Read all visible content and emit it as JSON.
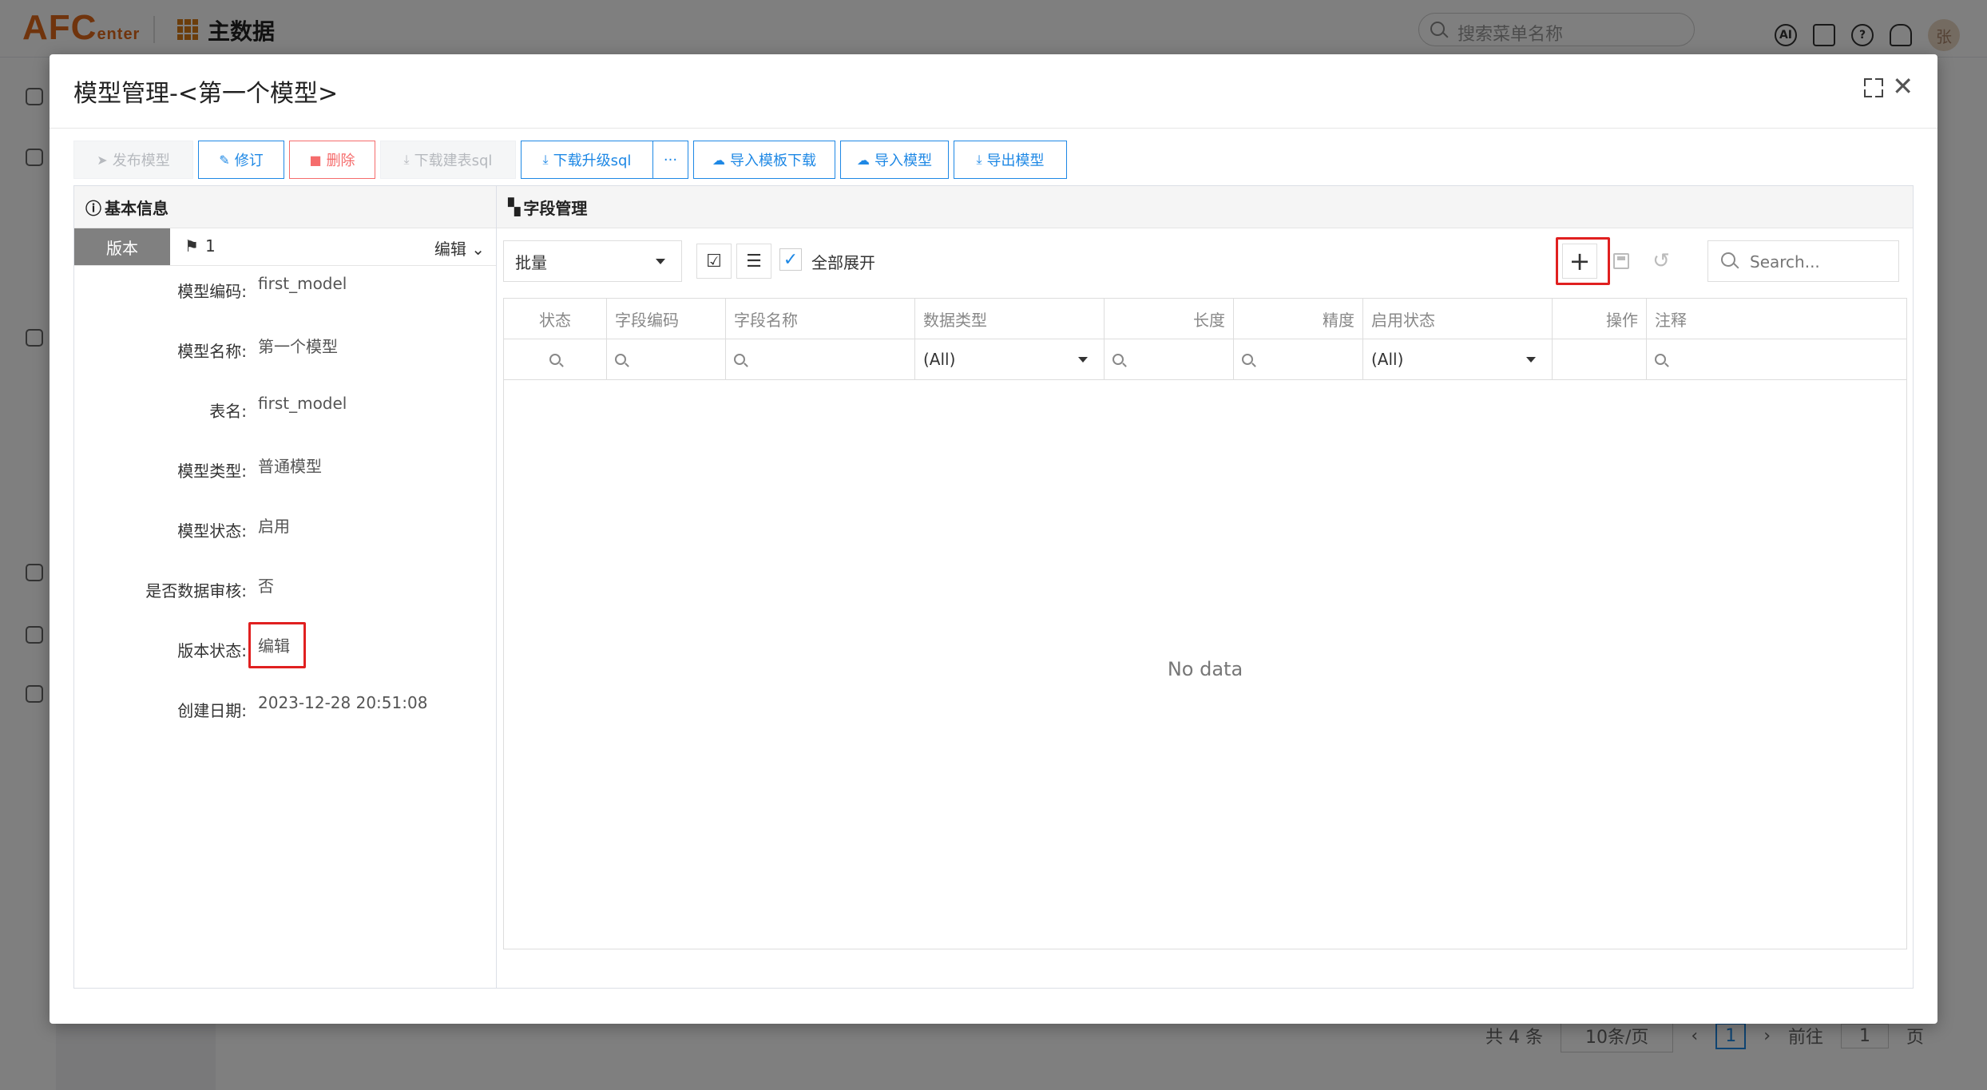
{
  "app": {
    "logo_main": "AFC",
    "logo_sub": "enter",
    "title": "主数据",
    "search_placeholder": "搜索菜单名称",
    "avatar_text": "张",
    "ai_icon_text": "AI",
    "help_icon_text": "?"
  },
  "background_footer": {
    "total": "共 4 条",
    "page_size": "10条/页",
    "current_page": "1",
    "goto_label": "前往",
    "goto_value": "1",
    "page_unit": "页"
  },
  "dialog": {
    "title": "模型管理-<第一个模型>",
    "toolbar": [
      {
        "label": "发布模型",
        "icon": "send-icon",
        "state": "disabled"
      },
      {
        "label": "修订",
        "icon": "edit-icon",
        "state": "primary"
      },
      {
        "label": "删除",
        "icon": "trash-icon",
        "state": "danger"
      },
      {
        "label": "下载建表sql",
        "icon": "download-icon",
        "state": "disabled"
      },
      {
        "label": "下载升级sql",
        "icon": "download-icon",
        "state": "primary"
      },
      {
        "label": "···",
        "icon": "more-icon",
        "state": "primary"
      },
      {
        "label": "导入模板下载",
        "icon": "cloud-icon",
        "state": "primary"
      },
      {
        "label": "导入模型",
        "icon": "cloud-icon",
        "state": "primary"
      },
      {
        "label": "导出模型",
        "icon": "download-icon",
        "state": "primary"
      }
    ],
    "basic_info": {
      "header": "基本信息",
      "version_tab": "版本",
      "version_no": "1",
      "version_action": "编辑",
      "fields": [
        {
          "label": "模型编码:",
          "value": "first_model"
        },
        {
          "label": "模型名称:",
          "value": "第一个模型"
        },
        {
          "label": "表名:",
          "value": "first_model"
        },
        {
          "label": "模型类型:",
          "value": "普通模型"
        },
        {
          "label": "模型状态:",
          "value": "启用"
        },
        {
          "label": "是否数据审核:",
          "value": "否"
        },
        {
          "label": "版本状态:",
          "value": "编辑"
        },
        {
          "label": "创建日期:",
          "value": "2023-12-28 20:51:08"
        }
      ]
    },
    "field_mgmt": {
      "header": "字段管理",
      "batch_label": "批量",
      "expand_all_label": "全部展开",
      "expand_all_checked": true,
      "search_placeholder": "Search...",
      "columns": [
        "状态",
        "字段编码",
        "字段名称",
        "数据类型",
        "长度",
        "精度",
        "启用状态",
        "操作",
        "注释"
      ],
      "filter_all": "(All)",
      "empty_text": "No data"
    }
  }
}
